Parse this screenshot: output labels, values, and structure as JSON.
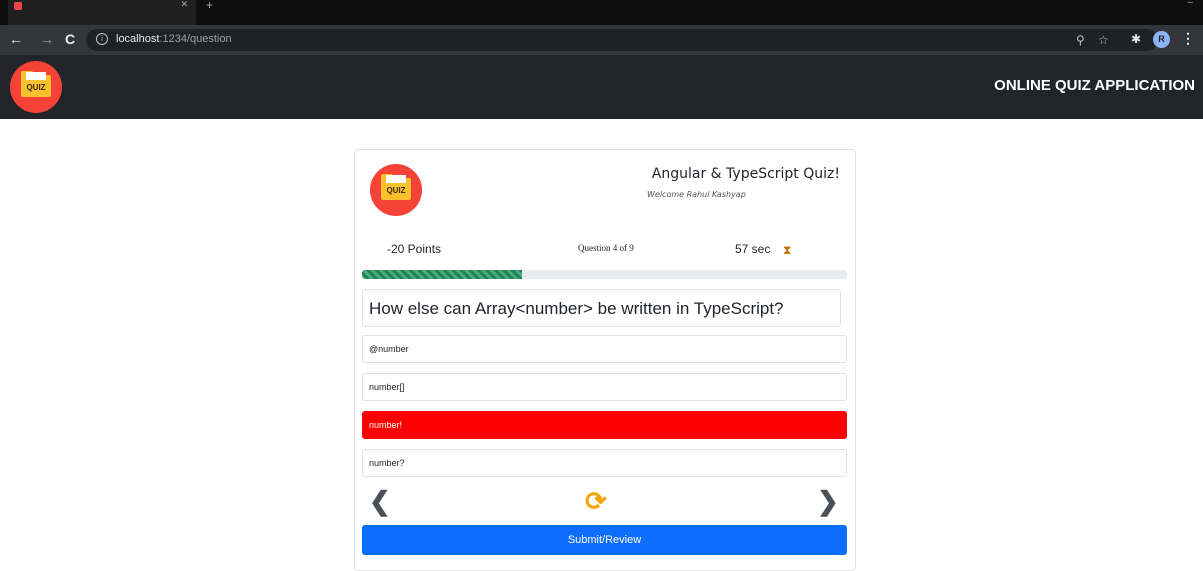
{
  "browser": {
    "url_host": "localhost",
    "url_port_path": ":1234/question",
    "profile_initial": "R"
  },
  "app": {
    "title": "ONLINE QUIZ APPLICATION",
    "logo_text": "QUIZ"
  },
  "quiz": {
    "title": "Angular & TypeScript Quiz!",
    "welcome": "Welcome Rahul Kashyap",
    "points": "-20 Points",
    "question_counter": "Question 4 of 9",
    "timer": "57 sec",
    "progress_fraction": 0.33,
    "question": "How else can Array<number> be written in TypeScript?",
    "options": [
      {
        "label": "@number",
        "state": "default"
      },
      {
        "label": "number[]",
        "state": "default"
      },
      {
        "label": "number!",
        "state": "wrong"
      },
      {
        "label": "number?",
        "state": "default"
      }
    ],
    "submit_label": "Submit/Review"
  },
  "colors": {
    "wrong": "#ff0000",
    "submit": "#0d6efd",
    "progress": "#198754",
    "appbar": "#212529",
    "refresh": "#f5a300"
  },
  "icons": [
    "back-arrow-icon",
    "forward-arrow-icon",
    "reload-icon",
    "info-icon",
    "zoom-icon",
    "star-icon",
    "extensions-icon",
    "menu-icon",
    "hourglass-icon",
    "chevron-left-icon",
    "chevron-right-icon",
    "refresh-icon"
  ]
}
